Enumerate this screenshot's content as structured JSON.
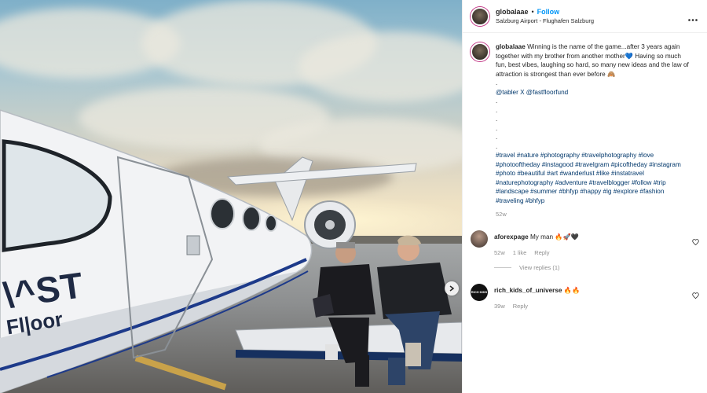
{
  "post": {
    "username": "globalaae",
    "follow_label": "Follow",
    "separator": "•",
    "location": "Salzburg Airport - Flughafen Salzburg",
    "aircraft_branding": {
      "line1": "\\^ST",
      "line2": "Fl|oor"
    }
  },
  "caption": {
    "username": "globalaae",
    "text_lines": [
      "Winning is the name of the game...after 3 years again",
      "together with my brother from another mother💙 Having so much",
      "fun, best vibes, laughing so hard, so many new ideas and the law of",
      "attraction is strongest than ever before 🙈"
    ],
    "dots_before": [
      "."
    ],
    "mention_line": "@tabler X @fastfloorfund",
    "dots_after": [
      ".",
      ".",
      ".",
      ".",
      ".",
      "."
    ],
    "hashtag_lines": [
      "#travel #nature #photography #travelphotography #love",
      "#photooftheday #instagood #travelgram #picoftheday #instagram",
      "#photo #beautiful #art #wanderlust #like #instatravel",
      "#naturephotography #adventure #travelblogger #follow #trip",
      "#landscape #summer #bhfyp #happy #ig #explore #fashion",
      "#traveling #bhfyp"
    ],
    "age": "52w"
  },
  "comments": [
    {
      "username": "aforexpage",
      "text": "My man 🔥🚀🖤",
      "age": "52w",
      "likes": "1 like",
      "reply_label": "Reply",
      "view_replies": "View replies (1)"
    },
    {
      "username": "rich_kids_of_universe",
      "text": "🔥🔥",
      "age": "39w",
      "reply_label": "Reply",
      "avatar_text": "RICH KIDS"
    }
  ],
  "icons": {
    "more": "more-options-icon",
    "heart": "heart-icon",
    "next": "chevron-right-icon"
  },
  "colors": {
    "link": "#0095f6",
    "hashtag": "#00376b",
    "muted": "#8e8e8e"
  }
}
